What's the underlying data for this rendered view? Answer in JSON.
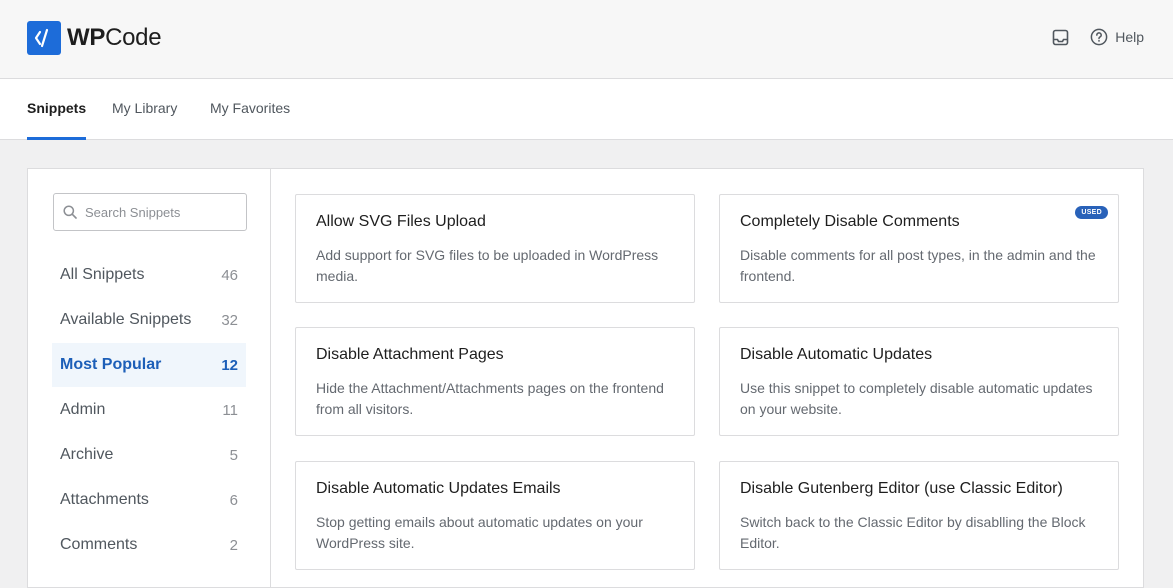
{
  "header": {
    "brand_prefix": "WP",
    "brand_suffix": "Code",
    "help_label": "Help"
  },
  "tabs": [
    {
      "label": "Snippets",
      "active": true
    },
    {
      "label": "My Library",
      "active": false
    },
    {
      "label": "My Favorites",
      "active": false
    }
  ],
  "search": {
    "placeholder": "Search Snippets",
    "value": ""
  },
  "categories": [
    {
      "label": "All Snippets",
      "count": "46"
    },
    {
      "label": "Available Snippets",
      "count": "32"
    },
    {
      "label": "Most Popular",
      "count": "12",
      "active": true
    },
    {
      "label": "Admin",
      "count": "11"
    },
    {
      "label": "Archive",
      "count": "5"
    },
    {
      "label": "Attachments",
      "count": "6"
    },
    {
      "label": "Comments",
      "count": "2"
    }
  ],
  "snippets": [
    {
      "title": "Allow SVG Files Upload",
      "description": "Add support for SVG files to be uploaded in WordPress media."
    },
    {
      "title": "Completely Disable Comments",
      "description": "Disable comments for all post types, in the admin and the frontend.",
      "badge": "USED"
    },
    {
      "title": "Disable Attachment Pages",
      "description": "Hide the Attachment/Attachments pages on the frontend from all visitors."
    },
    {
      "title": "Disable Automatic Updates",
      "description": "Use this snippet to completely disable automatic updates on your website."
    },
    {
      "title": "Disable Automatic Updates Emails",
      "description": "Stop getting emails about automatic updates on your WordPress site."
    },
    {
      "title": "Disable Gutenberg Editor (use Classic Editor)",
      "description": "Switch back to the Classic Editor by disablling the Block Editor."
    }
  ],
  "colors": {
    "accent": "#1d6cd9",
    "badge": "#2962b9",
    "active_bg": "#f0f6fc"
  }
}
